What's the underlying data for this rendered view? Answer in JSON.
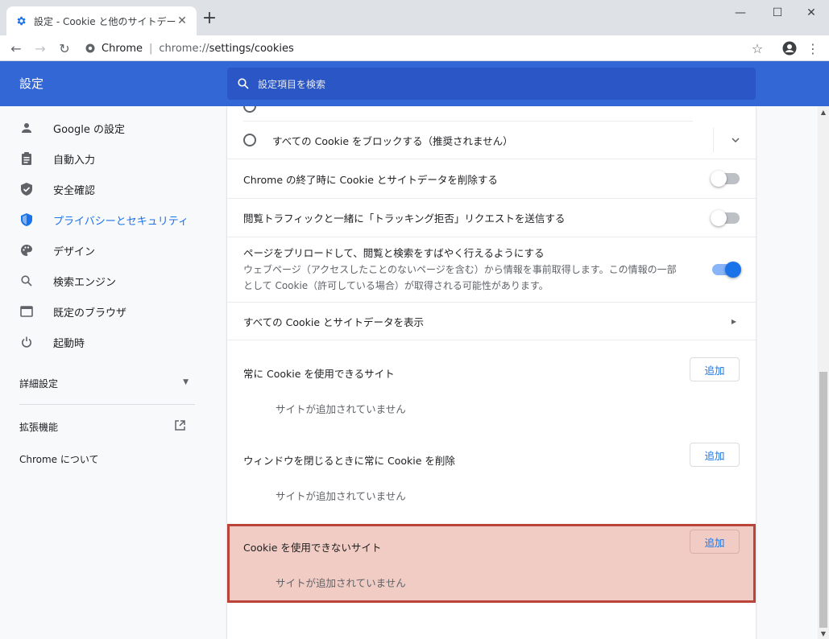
{
  "browser": {
    "tab_title": "設定 - Cookie と他のサイトデータ",
    "omnibox_site": "Chrome",
    "omnibox_separator": "|",
    "url_scheme": "chrome://",
    "url_path": "settings/cookies"
  },
  "header": {
    "title": "設定",
    "search_placeholder": "設定項目を検索"
  },
  "sidebar": {
    "items": [
      {
        "label": "Google の設定",
        "icon": "person-icon"
      },
      {
        "label": "自動入力",
        "icon": "clipboard-icon"
      },
      {
        "label": "安全確認",
        "icon": "shield-check-icon"
      },
      {
        "label": "プライバシーとセキュリティ",
        "icon": "shield-icon",
        "active": true
      },
      {
        "label": "デザイン",
        "icon": "palette-icon"
      },
      {
        "label": "検索エンジン",
        "icon": "search-icon"
      },
      {
        "label": "既定のブラウザ",
        "icon": "browser-icon"
      },
      {
        "label": "起動時",
        "icon": "power-icon"
      }
    ],
    "advanced": "詳細設定",
    "extensions": "拡張機能",
    "about": "Chrome について"
  },
  "content": {
    "block_all_label": "すべての Cookie をブロックする（推奨されません）",
    "clear_on_exit_label": "Chrome の終了時に Cookie とサイトデータを削除する",
    "dnt_label": "閲覧トラフィックと一緒に「トラッキング拒否」リクエストを送信する",
    "preload_title": "ページをプリロードして、閲覧と検索をすばやく行えるようにする",
    "preload_desc_1": "ウェブページ（アクセスしたことのないページを含む）から情報を事前取得します。この情報の一部",
    "preload_desc_2": "として Cookie（許可している場合）が取得される可能性があります。",
    "see_all_label": "すべての Cookie とサイトデータを表示",
    "allow_heading": "常に Cookie を使用できるサイト",
    "clear_heading": "ウィンドウを閉じるときに常に Cookie を削除",
    "block_heading": "Cookie を使用できないサイト",
    "add_label": "追加",
    "empty_text": "サイトが追加されていません"
  },
  "colors": {
    "header": "#3367d6",
    "accent": "#1a73e8",
    "highlight_fill": "#f0ccc4",
    "highlight_border": "#b8443a"
  }
}
